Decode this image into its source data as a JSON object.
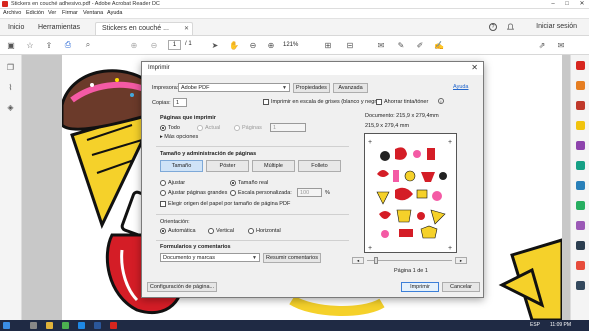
{
  "window": {
    "title": "Stickers en couché adhesivo.pdf - Adobe Acrobat Reader DC"
  },
  "menu": [
    "Archivo",
    "Edición",
    "Ver",
    "Firmar",
    "Ventana",
    "Ayuda"
  ],
  "tabs": {
    "home": "Inicio",
    "tools": "Herramientas",
    "doc": "Stickers en couché ..."
  },
  "header": {
    "signin": "Iniciar sesión"
  },
  "toolbar": {
    "page_current": "1",
    "page_total": "/ 1",
    "zoom": "121%"
  },
  "dialog": {
    "title": "Imprimir",
    "printer_label": "Impresora:",
    "printer_value": "Adobe PDF",
    "properties_button": "Propiedades",
    "advanced_button": "Avanzada",
    "help_link": "Ayuda",
    "copies_label": "Copias:",
    "copies_value": "1",
    "grayscale_label": "Imprimir en escala de grises (blanco y negro)",
    "save_ink_label": "Ahorrar tinta/tóner",
    "pages_section": "Páginas que imprimir",
    "opt_all": "Todo",
    "opt_current": "Actual",
    "opt_pages": "Páginas",
    "pages_value": "1",
    "more_options": "Más opciones",
    "size_section": "Tamaño y administración de páginas",
    "tg_size": "Tamaño",
    "tg_poster": "Póster",
    "tg_multiple": "Múltiple",
    "tg_booklet": "Folleto",
    "opt_fit": "Ajustar",
    "opt_actual": "Tamaño real",
    "opt_shrink": "Ajustar páginas grandes",
    "opt_custom": "Escala personalizada:",
    "scale_value": "100",
    "scale_unit": "%",
    "paper_source_label": "Elegir origen del papel por tamaño de página PDF",
    "orientation_section": "Orientación:",
    "opt_auto": "Automática",
    "opt_portrait": "Vertical",
    "opt_landscape": "Horizontal",
    "forms_section": "Formularios y comentarios",
    "forms_value": "Documento y marcas",
    "summarize_button": "Resumir comentarios",
    "document_size": "Documento: 215,9 x 279,4mm",
    "preview_size": "215,9 x 279,4 mm",
    "page_counter": "Página 1 de 1",
    "page_setup_button": "Configuración de página...",
    "print_button": "Imprimir",
    "cancel_button": "Cancelar"
  },
  "taskbar": {
    "lang": "ESP",
    "time": "11:09 PM"
  }
}
